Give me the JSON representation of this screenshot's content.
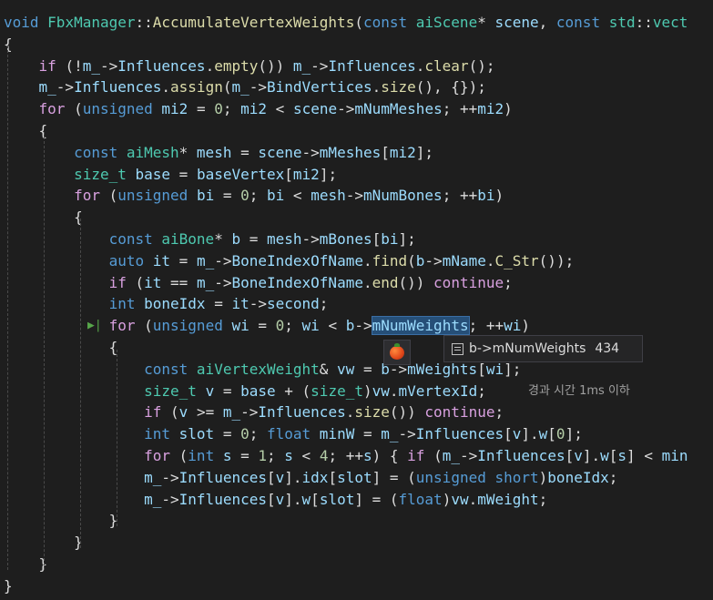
{
  "colors": {
    "background": "#1e1e1e",
    "keyword": "#569cd6",
    "type": "#4ec9b0",
    "function": "#dcdcaa",
    "variable": "#9cdcfe",
    "number": "#b5cea8",
    "text": "#dcdcdc",
    "control": "#d8a0df"
  },
  "code_lines": [
    [
      [
        "void ",
        "kw"
      ],
      [
        "FbxManager",
        "ty"
      ],
      [
        "::",
        "tx"
      ],
      [
        "AccumulateVertexWeights",
        "fn"
      ],
      [
        "(",
        "tx"
      ],
      [
        "const ",
        "kw"
      ],
      [
        "aiScene",
        "ty"
      ],
      [
        "* ",
        "tx"
      ],
      [
        "scene",
        "va"
      ],
      [
        ", ",
        "tx"
      ],
      [
        "const ",
        "kw"
      ],
      [
        "std",
        "ty"
      ],
      [
        "::",
        "tx"
      ],
      [
        "vect",
        "ty"
      ]
    ],
    [
      [
        "{",
        "tx"
      ]
    ],
    [
      [
        "    ",
        "tx"
      ],
      [
        "if ",
        "ct"
      ],
      [
        "(!",
        "tx"
      ],
      [
        "m_",
        "va"
      ],
      [
        "->",
        "tx"
      ],
      [
        "Influences",
        "va"
      ],
      [
        ".",
        "tx"
      ],
      [
        "empty",
        "fn"
      ],
      [
        "()) ",
        "tx"
      ],
      [
        "m_",
        "va"
      ],
      [
        "->",
        "tx"
      ],
      [
        "Influences",
        "va"
      ],
      [
        ".",
        "tx"
      ],
      [
        "clear",
        "fn"
      ],
      [
        "();",
        "tx"
      ]
    ],
    [
      [
        "    ",
        "tx"
      ],
      [
        "m_",
        "va"
      ],
      [
        "->",
        "tx"
      ],
      [
        "Influences",
        "va"
      ],
      [
        ".",
        "tx"
      ],
      [
        "assign",
        "fn"
      ],
      [
        "(",
        "tx"
      ],
      [
        "m_",
        "va"
      ],
      [
        "->",
        "tx"
      ],
      [
        "BindVertices",
        "va"
      ],
      [
        ".",
        "tx"
      ],
      [
        "size",
        "fn"
      ],
      [
        "(), {});",
        "tx"
      ]
    ],
    [
      [
        "    ",
        "tx"
      ],
      [
        "for ",
        "ct"
      ],
      [
        "(",
        "tx"
      ],
      [
        "unsigned ",
        "kw"
      ],
      [
        "mi2",
        "va"
      ],
      [
        " = ",
        "tx"
      ],
      [
        "0",
        "nu"
      ],
      [
        "; ",
        "tx"
      ],
      [
        "mi2",
        "va"
      ],
      [
        " < ",
        "tx"
      ],
      [
        "scene",
        "va"
      ],
      [
        "->",
        "tx"
      ],
      [
        "mNumMeshes",
        "va"
      ],
      [
        "; ++",
        "tx"
      ],
      [
        "mi2",
        "va"
      ],
      [
        ")",
        "tx"
      ]
    ],
    [
      [
        "    {",
        "tx"
      ]
    ],
    [
      [
        "        ",
        "tx"
      ],
      [
        "const ",
        "kw"
      ],
      [
        "aiMesh",
        "ty"
      ],
      [
        "* ",
        "tx"
      ],
      [
        "mesh",
        "va"
      ],
      [
        " = ",
        "tx"
      ],
      [
        "scene",
        "va"
      ],
      [
        "->",
        "tx"
      ],
      [
        "mMeshes",
        "va"
      ],
      [
        "[",
        "tx"
      ],
      [
        "mi2",
        "va"
      ],
      [
        "];",
        "tx"
      ]
    ],
    [
      [
        "        ",
        "tx"
      ],
      [
        "size_t ",
        "ty"
      ],
      [
        "base",
        "va"
      ],
      [
        " = ",
        "tx"
      ],
      [
        "baseVertex",
        "va"
      ],
      [
        "[",
        "tx"
      ],
      [
        "mi2",
        "va"
      ],
      [
        "];",
        "tx"
      ]
    ],
    [
      [
        "        ",
        "tx"
      ],
      [
        "for ",
        "ct"
      ],
      [
        "(",
        "tx"
      ],
      [
        "unsigned ",
        "kw"
      ],
      [
        "bi",
        "va"
      ],
      [
        " = ",
        "tx"
      ],
      [
        "0",
        "nu"
      ],
      [
        "; ",
        "tx"
      ],
      [
        "bi",
        "va"
      ],
      [
        " < ",
        "tx"
      ],
      [
        "mesh",
        "va"
      ],
      [
        "->",
        "tx"
      ],
      [
        "mNumBones",
        "va"
      ],
      [
        "; ++",
        "tx"
      ],
      [
        "bi",
        "va"
      ],
      [
        ")",
        "tx"
      ]
    ],
    [
      [
        "        {",
        "tx"
      ]
    ],
    [
      [
        "            ",
        "tx"
      ],
      [
        "const ",
        "kw"
      ],
      [
        "aiBone",
        "ty"
      ],
      [
        "* ",
        "tx"
      ],
      [
        "b",
        "va"
      ],
      [
        " = ",
        "tx"
      ],
      [
        "mesh",
        "va"
      ],
      [
        "->",
        "tx"
      ],
      [
        "mBones",
        "va"
      ],
      [
        "[",
        "tx"
      ],
      [
        "bi",
        "va"
      ],
      [
        "];",
        "tx"
      ]
    ],
    [
      [
        "            ",
        "tx"
      ],
      [
        "auto ",
        "kw"
      ],
      [
        "it",
        "va"
      ],
      [
        " = ",
        "tx"
      ],
      [
        "m_",
        "va"
      ],
      [
        "->",
        "tx"
      ],
      [
        "BoneIndexOfName",
        "va"
      ],
      [
        ".",
        "tx"
      ],
      [
        "find",
        "fn"
      ],
      [
        "(",
        "tx"
      ],
      [
        "b",
        "va"
      ],
      [
        "->",
        "tx"
      ],
      [
        "mName",
        "va"
      ],
      [
        ".",
        "tx"
      ],
      [
        "C_Str",
        "fn"
      ],
      [
        "());",
        "tx"
      ]
    ],
    [
      [
        "            ",
        "tx"
      ],
      [
        "if ",
        "ct"
      ],
      [
        "(",
        "tx"
      ],
      [
        "it",
        "va"
      ],
      [
        " == ",
        "tx"
      ],
      [
        "m_",
        "va"
      ],
      [
        "->",
        "tx"
      ],
      [
        "BoneIndexOfName",
        "va"
      ],
      [
        ".",
        "tx"
      ],
      [
        "end",
        "fn"
      ],
      [
        "()) ",
        "tx"
      ],
      [
        "continue",
        "ct"
      ],
      [
        ";",
        "tx"
      ]
    ],
    [
      [
        "            ",
        "tx"
      ],
      [
        "int ",
        "kw"
      ],
      [
        "boneIdx",
        "va"
      ],
      [
        " = ",
        "tx"
      ],
      [
        "it",
        "va"
      ],
      [
        "->",
        "tx"
      ],
      [
        "second",
        "va"
      ],
      [
        ";",
        "tx"
      ]
    ],
    [
      [
        "            ",
        "tx"
      ],
      [
        "for ",
        "ct"
      ],
      [
        "(",
        "tx"
      ],
      [
        "unsigned ",
        "kw"
      ],
      [
        "wi",
        "va"
      ],
      [
        " = ",
        "tx"
      ],
      [
        "0",
        "nu"
      ],
      [
        "; ",
        "tx"
      ],
      [
        "wi",
        "va"
      ],
      [
        " < ",
        "tx"
      ],
      [
        "b",
        "va"
      ],
      [
        "->",
        "tx"
      ],
      [
        "mNumWeights",
        "hl"
      ],
      [
        "; ++",
        "tx"
      ],
      [
        "wi",
        "va"
      ],
      [
        ")",
        "tx"
      ]
    ],
    [
      [
        "            {",
        "tx"
      ]
    ],
    [
      [
        "                ",
        "tx"
      ],
      [
        "const ",
        "kw"
      ],
      [
        "aiVertexWeight",
        "ty"
      ],
      [
        "& ",
        "tx"
      ],
      [
        "vw",
        "va"
      ],
      [
        " = ",
        "tx"
      ],
      [
        "b",
        "va"
      ],
      [
        "->",
        "tx"
      ],
      [
        "mWeights",
        "va"
      ],
      [
        "[",
        "tx"
      ],
      [
        "wi",
        "va"
      ],
      [
        "];",
        "tx"
      ]
    ],
    [
      [
        "                ",
        "tx"
      ],
      [
        "size_t ",
        "ty"
      ],
      [
        "v",
        "va"
      ],
      [
        " = ",
        "tx"
      ],
      [
        "base",
        "va"
      ],
      [
        " + (",
        "tx"
      ],
      [
        "size_t",
        "ty"
      ],
      [
        ")",
        "tx"
      ],
      [
        "vw",
        "va"
      ],
      [
        ".",
        "tx"
      ],
      [
        "mVertexId",
        "va"
      ],
      [
        ";",
        "tx"
      ]
    ],
    [
      [
        "                ",
        "tx"
      ],
      [
        "if ",
        "ct"
      ],
      [
        "(",
        "tx"
      ],
      [
        "v",
        "va"
      ],
      [
        " >= ",
        "tx"
      ],
      [
        "m_",
        "va"
      ],
      [
        "->",
        "tx"
      ],
      [
        "Influences",
        "va"
      ],
      [
        ".",
        "tx"
      ],
      [
        "size",
        "fn"
      ],
      [
        "()) ",
        "tx"
      ],
      [
        "continue",
        "ct"
      ],
      [
        ";",
        "tx"
      ]
    ],
    [
      [
        "                ",
        "tx"
      ],
      [
        "int ",
        "kw"
      ],
      [
        "slot",
        "va"
      ],
      [
        " = ",
        "tx"
      ],
      [
        "0",
        "nu"
      ],
      [
        "; ",
        "tx"
      ],
      [
        "float ",
        "kw"
      ],
      [
        "minW",
        "va"
      ],
      [
        " = ",
        "tx"
      ],
      [
        "m_",
        "va"
      ],
      [
        "->",
        "tx"
      ],
      [
        "Influences",
        "va"
      ],
      [
        "[",
        "tx"
      ],
      [
        "v",
        "va"
      ],
      [
        "].",
        "tx"
      ],
      [
        "w",
        "va"
      ],
      [
        "[",
        "tx"
      ],
      [
        "0",
        "nu"
      ],
      [
        "];",
        "tx"
      ]
    ],
    [
      [
        "                ",
        "tx"
      ],
      [
        "for ",
        "ct"
      ],
      [
        "(",
        "tx"
      ],
      [
        "int ",
        "kw"
      ],
      [
        "s",
        "va"
      ],
      [
        " = ",
        "tx"
      ],
      [
        "1",
        "nu"
      ],
      [
        "; ",
        "tx"
      ],
      [
        "s",
        "va"
      ],
      [
        " < ",
        "tx"
      ],
      [
        "4",
        "nu"
      ],
      [
        "; ++",
        "tx"
      ],
      [
        "s",
        "va"
      ],
      [
        ") { ",
        "tx"
      ],
      [
        "if ",
        "ct"
      ],
      [
        "(",
        "tx"
      ],
      [
        "m_",
        "va"
      ],
      [
        "->",
        "tx"
      ],
      [
        "Influences",
        "va"
      ],
      [
        "[",
        "tx"
      ],
      [
        "v",
        "va"
      ],
      [
        "].",
        "tx"
      ],
      [
        "w",
        "va"
      ],
      [
        "[",
        "tx"
      ],
      [
        "s",
        "va"
      ],
      [
        "] < ",
        "tx"
      ],
      [
        "min",
        "va"
      ]
    ],
    [
      [
        "                ",
        "tx"
      ],
      [
        "m_",
        "va"
      ],
      [
        "->",
        "tx"
      ],
      [
        "Influences",
        "va"
      ],
      [
        "[",
        "tx"
      ],
      [
        "v",
        "va"
      ],
      [
        "].",
        "tx"
      ],
      [
        "idx",
        "va"
      ],
      [
        "[",
        "tx"
      ],
      [
        "slot",
        "va"
      ],
      [
        "] = (",
        "tx"
      ],
      [
        "unsigned ",
        "kw"
      ],
      [
        "short",
        "kw"
      ],
      [
        ")",
        "tx"
      ],
      [
        "boneIdx",
        "va"
      ],
      [
        ";",
        "tx"
      ]
    ],
    [
      [
        "                ",
        "tx"
      ],
      [
        "m_",
        "va"
      ],
      [
        "->",
        "tx"
      ],
      [
        "Influences",
        "va"
      ],
      [
        "[",
        "tx"
      ],
      [
        "v",
        "va"
      ],
      [
        "].",
        "tx"
      ],
      [
        "w",
        "va"
      ],
      [
        "[",
        "tx"
      ],
      [
        "slot",
        "va"
      ],
      [
        "] = (",
        "tx"
      ],
      [
        "float",
        "kw"
      ],
      [
        ")",
        "tx"
      ],
      [
        "vw",
        "va"
      ],
      [
        ".",
        "tx"
      ],
      [
        "mWeight",
        "va"
      ],
      [
        ";",
        "tx"
      ]
    ],
    [
      [
        "            }",
        "tx"
      ]
    ],
    [
      [
        "        }",
        "tx"
      ]
    ],
    [
      [
        "    }",
        "tx"
      ]
    ],
    [
      [
        "}",
        "tx"
      ]
    ]
  ],
  "datatip": {
    "expression": "b->mNumWeights",
    "value": "434",
    "icon": "field-icon"
  },
  "perf_tip": {
    "text": "경과 시간 1ms 이하"
  },
  "run_to_click": {
    "glyph": "▶|",
    "icon": "run-to-click-icon"
  },
  "code_icon": {
    "icon": "tomato-icon"
  }
}
